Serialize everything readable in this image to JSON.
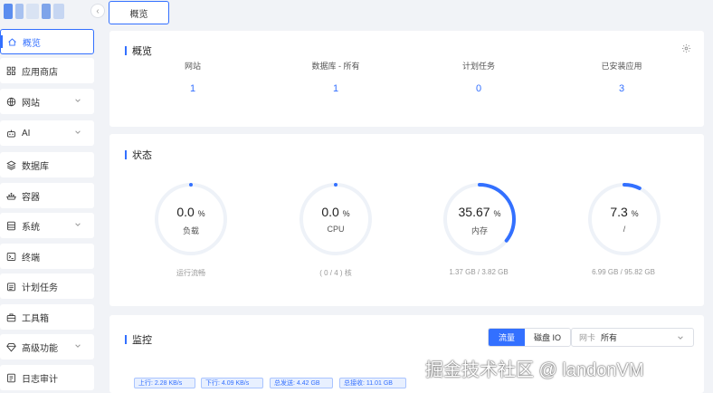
{
  "sidebar": {
    "items": [
      {
        "label": "概览",
        "icon": "home-icon",
        "active": true,
        "expandable": false
      },
      {
        "label": "应用商店",
        "icon": "grid-icon",
        "active": false,
        "expandable": false
      },
      {
        "label": "网站",
        "icon": "globe-icon",
        "active": false,
        "expandable": true
      },
      {
        "label": "AI",
        "icon": "robot-icon",
        "active": false,
        "expandable": true
      },
      {
        "label": "数据库",
        "icon": "layers-icon",
        "active": false,
        "expandable": false
      },
      {
        "label": "容器",
        "icon": "container-icon",
        "active": false,
        "expandable": false
      },
      {
        "label": "系统",
        "icon": "server-icon",
        "active": false,
        "expandable": true
      },
      {
        "label": "终端",
        "icon": "terminal-icon",
        "active": false,
        "expandable": false
      },
      {
        "label": "计划任务",
        "icon": "calendar-icon",
        "active": false,
        "expandable": false
      },
      {
        "label": "工具箱",
        "icon": "toolbox-icon",
        "active": false,
        "expandable": false
      },
      {
        "label": "高级功能",
        "icon": "diamond-icon",
        "active": false,
        "expandable": true
      },
      {
        "label": "日志审计",
        "icon": "log-icon",
        "active": false,
        "expandable": false
      }
    ]
  },
  "tabs": [
    {
      "label": "概览"
    }
  ],
  "overview": {
    "title": "概览",
    "stats": [
      {
        "label": "网站",
        "value": "1"
      },
      {
        "label": "数据库 - 所有",
        "value": "1"
      },
      {
        "label": "计划任务",
        "value": "0"
      },
      {
        "label": "已安装应用",
        "value": "3"
      }
    ]
  },
  "status": {
    "title": "状态",
    "gauges": [
      {
        "value": "0.0",
        "unit": "%",
        "label": "负载",
        "footer": "运行流畅",
        "percent": 0
      },
      {
        "value": "0.0",
        "unit": "%",
        "label": "CPU",
        "footer": "( 0 / 4 ) 核",
        "percent": 0
      },
      {
        "value": "35.67",
        "unit": "%",
        "label": "内存",
        "footer": "1.37 GB / 3.82 GB",
        "percent": 35.67
      },
      {
        "value": "7.3",
        "unit": "%",
        "label": "/",
        "footer": "6.99 GB / 95.82 GB",
        "percent": 7.3
      }
    ]
  },
  "monitor": {
    "title": "监控",
    "toggle": {
      "active": "流量",
      "inactive": "磁盘 IO"
    },
    "nic": {
      "prefix": "网卡",
      "value": "所有"
    },
    "chips": [
      "上行: 2.28 KB/s",
      "下行: 4.09 KB/s",
      "总发送: 4.42 GB",
      "总接收: 11.01 GB"
    ]
  },
  "watermark": "掘金技术社区 @ landonVM",
  "colors": {
    "accent": "#3370ff",
    "track": "#eef2f8",
    "background": "#f1f3f7"
  }
}
